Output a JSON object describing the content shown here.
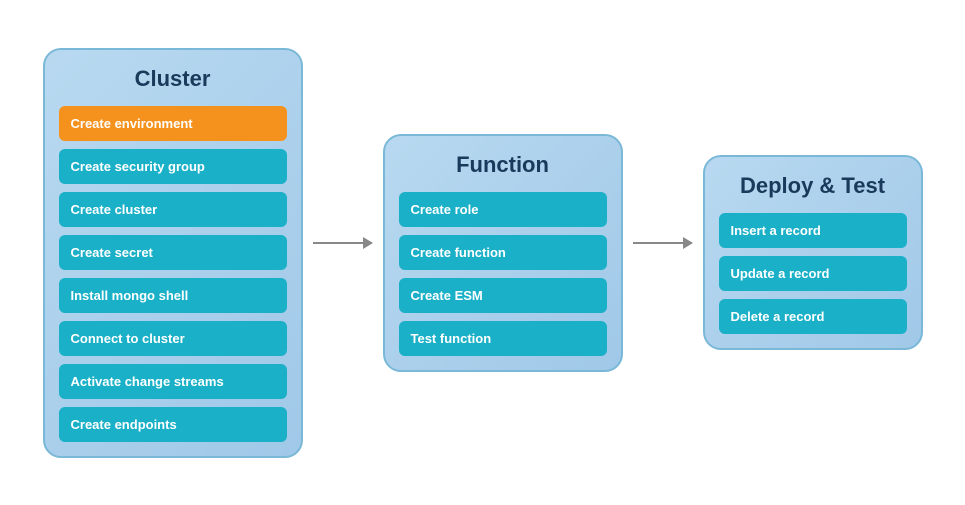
{
  "panels": {
    "cluster": {
      "title": "Cluster",
      "steps": [
        {
          "label": "Create environment",
          "style": "orange"
        },
        {
          "label": "Create security group",
          "style": "teal"
        },
        {
          "label": "Create cluster",
          "style": "teal"
        },
        {
          "label": "Create secret",
          "style": "teal"
        },
        {
          "label": "Install mongo shell",
          "style": "teal"
        },
        {
          "label": "Connect to cluster",
          "style": "teal"
        },
        {
          "label": "Activate change streams",
          "style": "teal"
        },
        {
          "label": "Create endpoints",
          "style": "teal"
        }
      ]
    },
    "function": {
      "title": "Function",
      "steps": [
        {
          "label": "Create role",
          "style": "teal"
        },
        {
          "label": "Create function",
          "style": "teal"
        },
        {
          "label": "Create ESM",
          "style": "teal"
        },
        {
          "label": "Test function",
          "style": "teal"
        }
      ]
    },
    "deploy": {
      "title": "Deploy & Test",
      "steps": [
        {
          "label": "Insert a record",
          "style": "teal"
        },
        {
          "label": "Update a record",
          "style": "teal"
        },
        {
          "label": "Delete a record",
          "style": "teal"
        }
      ]
    }
  },
  "arrows": [
    {
      "id": "arrow-1"
    },
    {
      "id": "arrow-2"
    }
  ]
}
